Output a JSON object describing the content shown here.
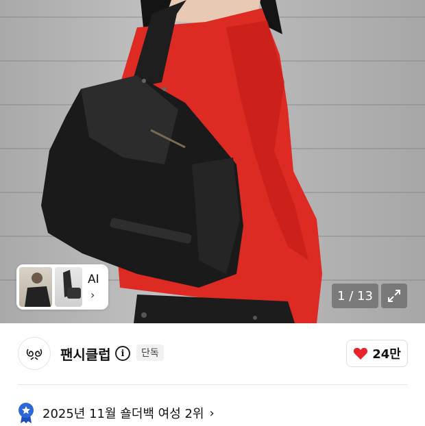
{
  "gallery": {
    "counter": "1 / 13",
    "ai_label": "AI",
    "ai_chevron": "›",
    "expand_icon": "expand-arrows-icon"
  },
  "store": {
    "name": "팬시클럽",
    "badge": "단독",
    "info_icon": "i",
    "like_count": "24만",
    "heart_color": "#e5242b"
  },
  "ranking": {
    "text": "2025년 11월 숄더백 여성 2위",
    "chevron": "›",
    "badge_color": "#2b67d9"
  }
}
